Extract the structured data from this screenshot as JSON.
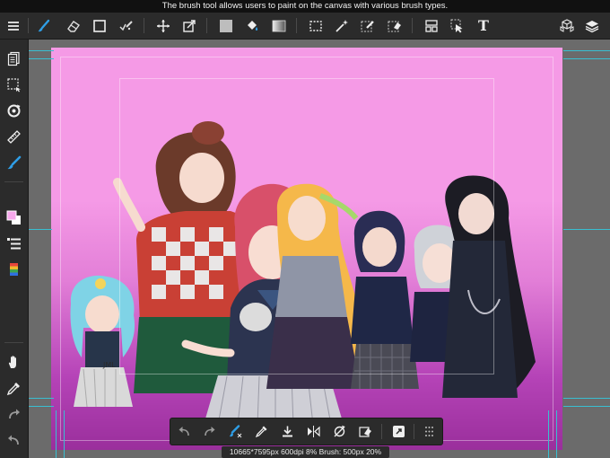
{
  "tooltip": {
    "text": "The brush tool allows users to paint on the canvas with various brush types."
  },
  "toolbar": {
    "left": [
      "menu-icon",
      "brush-icon",
      "eraser-icon",
      "shape-icon",
      "edit-icon"
    ],
    "transform": [
      "move-icon",
      "transform-icon"
    ],
    "fill": [
      "fill-color-icon",
      "bucket-icon",
      "gradient-icon"
    ],
    "select": [
      "rect-select-icon",
      "magic-wand-icon",
      "select-pen-icon",
      "select-eraser-icon"
    ],
    "right": [
      "snap-icon",
      "pointer-icon",
      "text-icon"
    ],
    "far_right": [
      "materials-icon",
      "layers-icon"
    ],
    "text_label": "T"
  },
  "sidebar": {
    "items": [
      "pages-icon",
      "selection-icon",
      "rotate-icon",
      "ruler-icon",
      "brush-stroke-icon",
      "color-icon",
      "layer-list-icon",
      "palette-icon",
      "hand-icon",
      "eyedropper-icon",
      "redo-icon",
      "undo-icon"
    ]
  },
  "bottom_bar": {
    "items": [
      "undo-icon",
      "redo-icon",
      "brush-dropper-icon",
      "eyedropper-icon",
      "save-icon",
      "flip-icon",
      "rotate-reset-icon",
      "clear-icon",
      "expand-icon",
      "grid-dots-icon"
    ]
  },
  "status": {
    "text": "10665*7595px 600dpi 8% Brush: 500px 20%"
  },
  "colors": {
    "panel": "#2b2b2b",
    "accent": "#2f9ee6",
    "canvas_pink": "#f59ae6",
    "canvas_purple": "#9a2f9c",
    "guide_cyan": "#39bfd1"
  }
}
